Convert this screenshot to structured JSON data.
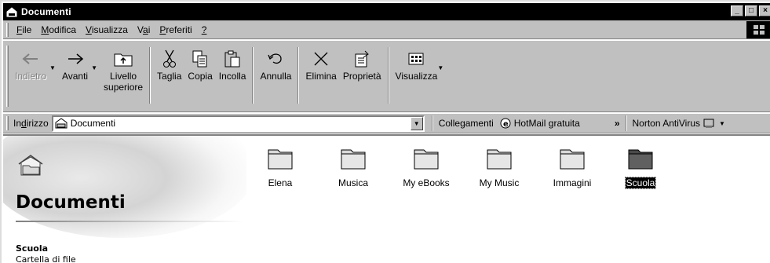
{
  "window": {
    "title": "Documenti",
    "buttons": [
      "minimize",
      "maximize",
      "close"
    ]
  },
  "menubar": {
    "items": [
      {
        "pre": "",
        "key": "F",
        "post": "ile"
      },
      {
        "pre": "",
        "key": "M",
        "post": "odifica"
      },
      {
        "pre": "",
        "key": "V",
        "post": "isualizza"
      },
      {
        "pre": "V",
        "key": "a",
        "post": "i"
      },
      {
        "pre": "",
        "key": "P",
        "post": "referiti"
      },
      {
        "pre": "",
        "key": "?",
        "post": ""
      }
    ]
  },
  "toolbar": {
    "back_label": "Indietro",
    "forward_label": "Avanti",
    "up_label_1": "Livello",
    "up_label_2": "superiore",
    "cut_label": "Taglia",
    "copy_label": "Copia",
    "paste_label": "Incolla",
    "undo_label": "Annulla",
    "delete_label": "Elimina",
    "properties_label": "Proprietà",
    "views_label": "Visualizza"
  },
  "addressbar": {
    "label_pre": "In",
    "label_key": "d",
    "label_post": "irizzo",
    "value": "Documenti",
    "links_label": "Collegamenti",
    "hotmail_label": "HotMail gratuita",
    "more_chevron": "»",
    "norton_label": "Norton AntiVirus"
  },
  "content": {
    "title": "Documenti",
    "selected_name": "Scuola",
    "selected_type": "Cartella di file",
    "folders": [
      {
        "name": "Elena",
        "selected": false
      },
      {
        "name": "Musica",
        "selected": false
      },
      {
        "name": "My eBooks",
        "selected": false
      },
      {
        "name": "My Music",
        "selected": false
      },
      {
        "name": "Immagini",
        "selected": false
      },
      {
        "name": "Scuola",
        "selected": true
      }
    ]
  },
  "colors": {
    "titlebar_bg": "#000000",
    "chrome": "#c0c0c0",
    "selection": "#000000"
  }
}
